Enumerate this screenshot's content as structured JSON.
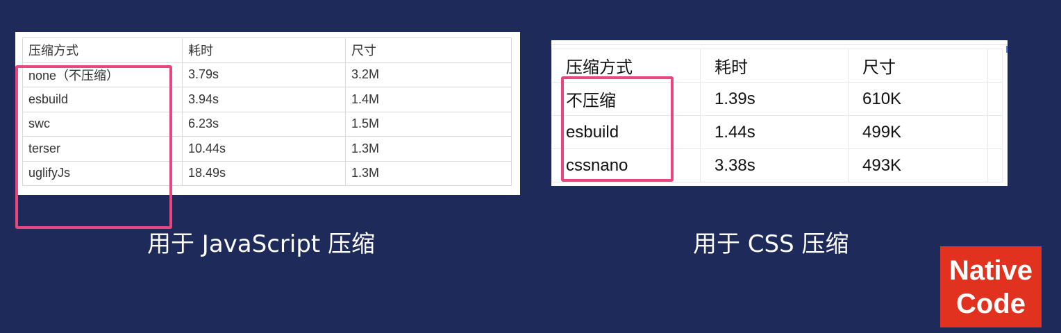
{
  "js_table": {
    "headers": [
      "压缩方式",
      "耗时",
      "尺寸"
    ],
    "rows": [
      [
        "none（不压缩）",
        "3.79s",
        "3.2M"
      ],
      [
        "esbuild",
        "3.94s",
        "1.4M"
      ],
      [
        "swc",
        "6.23s",
        "1.5M"
      ],
      [
        "terser",
        "10.44s",
        "1.3M"
      ],
      [
        "uglifyJs",
        "18.49s",
        "1.3M"
      ]
    ]
  },
  "css_table": {
    "headers": [
      "压缩方式",
      "耗时",
      "尺寸"
    ],
    "rows": [
      [
        "不压缩",
        "1.39s",
        "610K"
      ],
      [
        "esbuild",
        "1.44s",
        "499K"
      ],
      [
        "cssnano",
        "3.38s",
        "493K"
      ]
    ]
  },
  "captions": {
    "js": "用于 JavaScript 压缩",
    "css": "用于 CSS 压缩"
  },
  "badge": {
    "line1": "Native",
    "line2": "Code"
  },
  "colors": {
    "background": "#1e2a5a",
    "highlight": "#e8467c",
    "badge": "#e0321f"
  }
}
